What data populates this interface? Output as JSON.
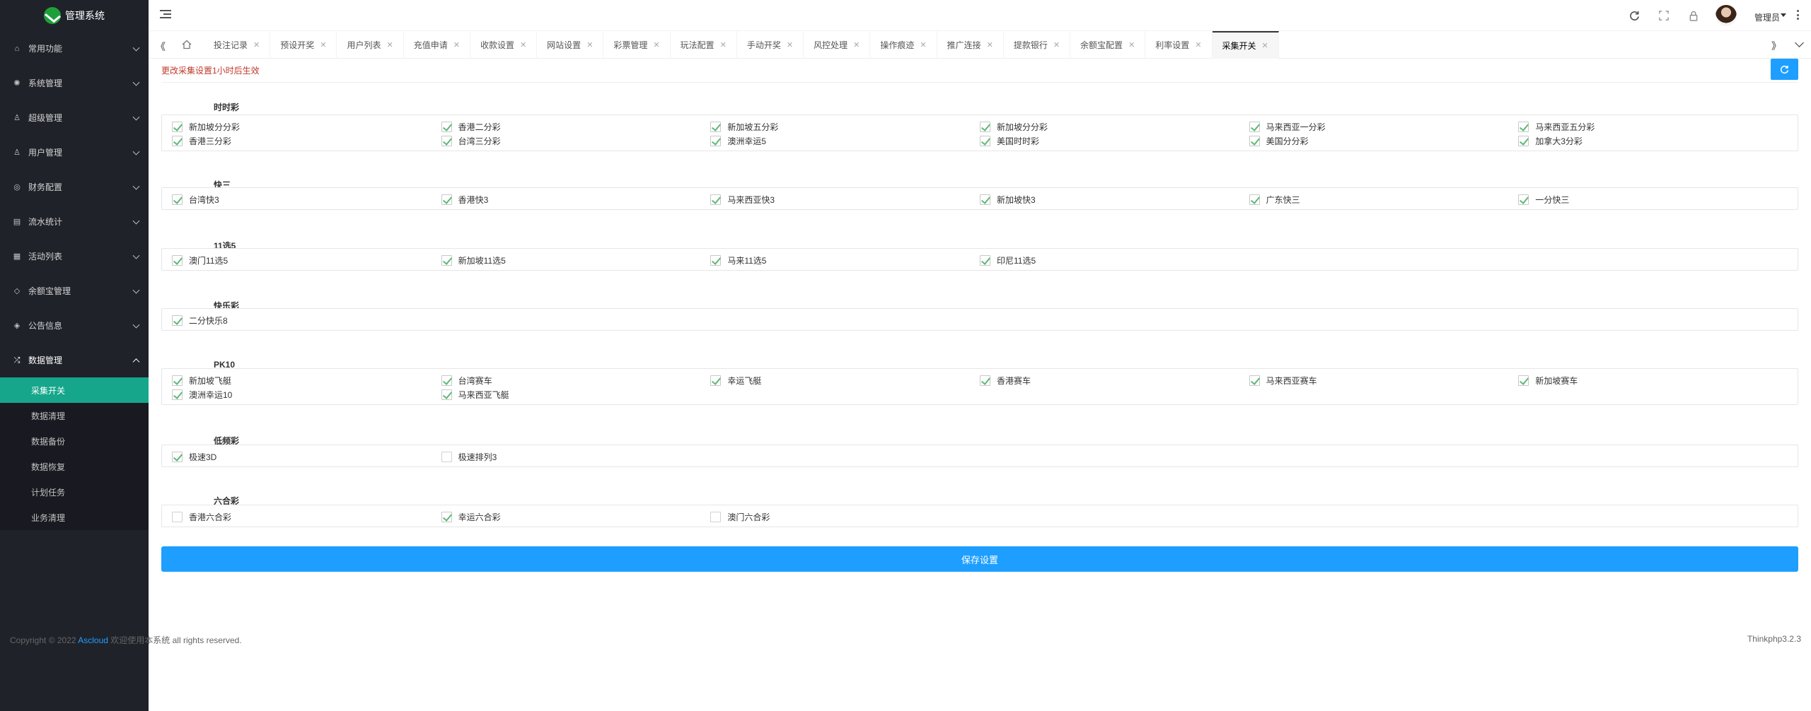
{
  "app": {
    "title": "管理系统"
  },
  "sidebar": {
    "items": [
      {
        "label": "常用功能",
        "icon": "home-icon",
        "glyph": "⌂"
      },
      {
        "label": "系统管理",
        "icon": "gear-icon",
        "glyph": "✺"
      },
      {
        "label": "超级管理",
        "icon": "user-icon",
        "glyph": "♙"
      },
      {
        "label": "用户管理",
        "icon": "users-icon",
        "glyph": "♙"
      },
      {
        "label": "财务配置",
        "icon": "finance-icon",
        "glyph": "◎"
      },
      {
        "label": "流水统计",
        "icon": "list-icon",
        "glyph": "▤"
      },
      {
        "label": "活动列表",
        "icon": "calendar-icon",
        "glyph": "▦"
      },
      {
        "label": "余额宝管理",
        "icon": "diamond-icon",
        "glyph": "◇"
      },
      {
        "label": "公告信息",
        "icon": "notice-icon",
        "glyph": "◈"
      },
      {
        "label": "数据管理",
        "icon": "data-icon",
        "glyph": "⤮"
      }
    ],
    "submenu": [
      {
        "label": "采集开关",
        "active": true
      },
      {
        "label": "数据清理"
      },
      {
        "label": "数据备份"
      },
      {
        "label": "数据恢复"
      },
      {
        "label": "计划任务"
      },
      {
        "label": "业务清理"
      }
    ]
  },
  "header": {
    "user_name": "管理员",
    "icons": [
      "refresh-icon",
      "fullscreen-icon",
      "lock-icon",
      "avatar",
      "more-icon"
    ]
  },
  "tabs": [
    {
      "label": "投注记录"
    },
    {
      "label": "预设开奖"
    },
    {
      "label": "用户列表"
    },
    {
      "label": "充值申请"
    },
    {
      "label": "收款设置"
    },
    {
      "label": "网站设置"
    },
    {
      "label": "彩票管理"
    },
    {
      "label": "玩法配置"
    },
    {
      "label": "手动开奖"
    },
    {
      "label": "风控处理"
    },
    {
      "label": "操作痕迹"
    },
    {
      "label": "推广连接"
    },
    {
      "label": "提款银行"
    },
    {
      "label": "余额宝配置"
    },
    {
      "label": "利率设置"
    },
    {
      "label": "采集开关",
      "active": true
    }
  ],
  "content": {
    "notice": "更改采集设置1小时后生效",
    "save_label": "保存设置",
    "groups": [
      {
        "title": "时时彩",
        "items": [
          {
            "label": "新加坡分分彩",
            "checked": true
          },
          {
            "label": "香港二分彩",
            "checked": true
          },
          {
            "label": "新加坡五分彩",
            "checked": true
          },
          {
            "label": "新加坡分分彩",
            "checked": true
          },
          {
            "label": "马来西亚一分彩",
            "checked": true
          },
          {
            "label": "马来西亚五分彩",
            "checked": true
          },
          {
            "label": "香港三分彩",
            "checked": true
          },
          {
            "label": "台湾三分彩",
            "checked": true
          },
          {
            "label": "澳洲幸运5",
            "checked": true
          },
          {
            "label": "美国时时彩",
            "checked": true
          },
          {
            "label": "美国分分彩",
            "checked": true
          },
          {
            "label": "加拿大3分彩",
            "checked": true
          }
        ]
      },
      {
        "title": "快三",
        "items": [
          {
            "label": "台湾快3",
            "checked": true
          },
          {
            "label": "香港快3",
            "checked": true
          },
          {
            "label": "马来西亚快3",
            "checked": true
          },
          {
            "label": "新加坡快3",
            "checked": true
          },
          {
            "label": "广东快三",
            "checked": true
          },
          {
            "label": "一分快三",
            "checked": true
          }
        ]
      },
      {
        "title": "11选5",
        "items": [
          {
            "label": "澳门11选5",
            "checked": true
          },
          {
            "label": "新加坡11选5",
            "checked": true
          },
          {
            "label": "马来11选5",
            "checked": true
          },
          {
            "label": "印尼11选5",
            "checked": true
          }
        ]
      },
      {
        "title": "快乐彩",
        "items": [
          {
            "label": "二分快乐8",
            "checked": true
          }
        ]
      },
      {
        "title": "PK10",
        "items": [
          {
            "label": "新加坡飞艇",
            "checked": true
          },
          {
            "label": "台湾赛车",
            "checked": true
          },
          {
            "label": "幸运飞艇",
            "checked": true
          },
          {
            "label": "香港赛车",
            "checked": true
          },
          {
            "label": "马来西亚赛车",
            "checked": true
          },
          {
            "label": "新加坡赛车",
            "checked": true
          },
          {
            "label": "澳洲幸运10",
            "checked": true
          },
          {
            "label": "马来西亚飞艇",
            "checked": true
          }
        ]
      },
      {
        "title": "低频彩",
        "items": [
          {
            "label": "极速3D",
            "checked": true
          },
          {
            "label": "极速排列3",
            "checked": false
          }
        ]
      },
      {
        "title": "六合彩",
        "items": [
          {
            "label": "香港六合彩",
            "checked": false
          },
          {
            "label": "幸运六合彩",
            "checked": true
          },
          {
            "label": "澳门六合彩",
            "checked": false
          }
        ]
      }
    ]
  },
  "footer": {
    "copyright_prefix": "Copyright © 2022 ",
    "brand": "Ascloud",
    "copyright_suffix": " 欢迎使用本系统 all rights reserved.",
    "version": "Thinkphp3.2.3"
  },
  "colors": {
    "sidebar_bg": "#20222a",
    "active_submenu": "#16a68b",
    "primary_button": "#1e9fff",
    "check_green": "#5fb878",
    "notice_red": "#c0392b"
  }
}
